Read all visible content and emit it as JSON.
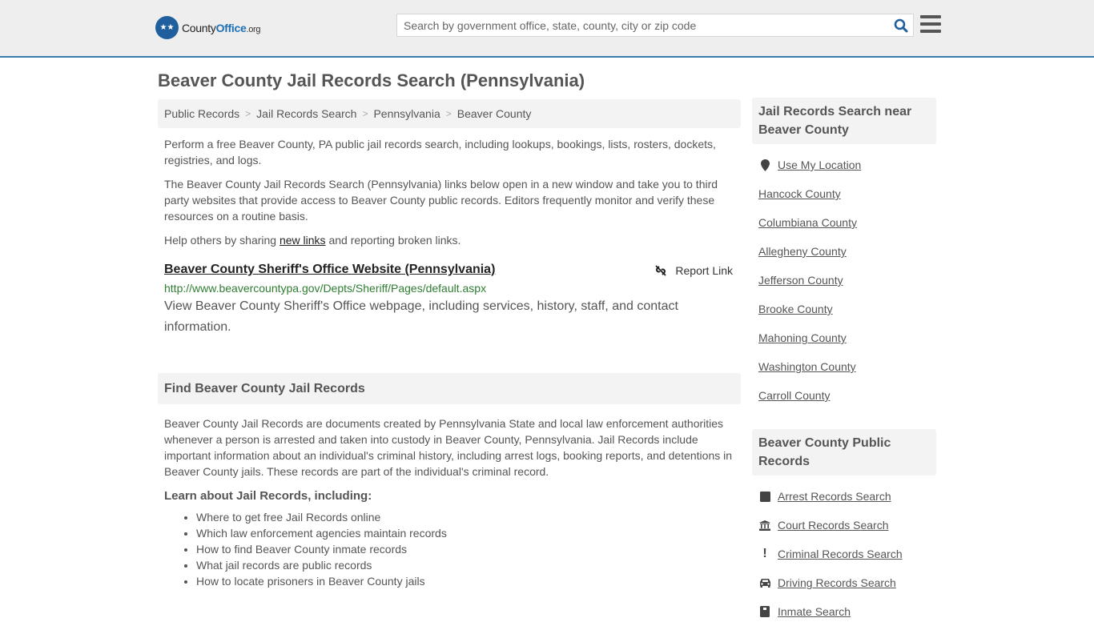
{
  "header": {
    "logo": {
      "brand_part1": "County",
      "brand_part2": "Office",
      "brand_suffix": ".org"
    },
    "search": {
      "placeholder": "Search by government office, state, county, city or zip code",
      "value": ""
    },
    "icons": {
      "search": "search-icon",
      "menu": "hamburger-menu-icon"
    }
  },
  "page": {
    "title": "Beaver County Jail Records Search (Pennsylvania)"
  },
  "breadcrumb": [
    {
      "label": "Public Records"
    },
    {
      "label": "Jail Records Search"
    },
    {
      "label": "Pennsylvania"
    },
    {
      "label": "Beaver County"
    }
  ],
  "intro": {
    "p1": "Perform a free Beaver County, PA public jail records search, including lookups, bookings, lists, rosters, dockets, registries, and logs.",
    "p2": "The Beaver County Jail Records Search (Pennsylvania) links below open in a new window and take you to third party websites that provide access to Beaver County public records. Editors frequently monitor and verify these resources on a routine basis.",
    "p3_before": "Help others by sharing ",
    "p3_link": "new links",
    "p3_after": " and reporting broken links."
  },
  "result": {
    "title": "Beaver County Sheriff's Office Website (Pennsylvania)",
    "report_label": "Report Link",
    "url": "http://www.beavercountypa.gov/Depts/Sheriff/Pages/default.aspx",
    "description": "View Beaver County Sheriff's Office webpage, including services, history, staff, and contact information."
  },
  "find_section": {
    "heading": "Find Beaver County Jail Records",
    "body": "Beaver County Jail Records are documents created by Pennsylvania State and local law enforcement authorities whenever a person is arrested and taken into custody in Beaver County, Pennsylvania. Jail Records include important information about an individual's criminal history, including arrest logs, booking reports, and detentions in Beaver County jails. These records are part of the individual's criminal record.",
    "learn_heading": "Learn about Jail Records, including:",
    "bullets": [
      "Where to get free Jail Records online",
      "Which law enforcement agencies maintain records",
      "How to find Beaver County inmate records",
      "What jail records are public records",
      "How to locate prisoners in Beaver County jails"
    ]
  },
  "sidebar": {
    "nearby": {
      "heading": "Jail Records Search near Beaver County",
      "use_location": "Use My Location",
      "counties": [
        "Hancock County",
        "Columbiana County",
        "Allegheny County",
        "Jefferson County",
        "Brooke County",
        "Mahoning County",
        "Washington County",
        "Carroll County"
      ]
    },
    "public_records": {
      "heading": "Beaver County Public Records",
      "items": [
        {
          "label": "Arrest Records Search",
          "icon": "book-icon"
        },
        {
          "label": "Court Records Search",
          "icon": "courthouse-icon"
        },
        {
          "label": "Criminal Records Search",
          "icon": "exclamation-icon"
        },
        {
          "label": "Driving Records Search",
          "icon": "car-icon"
        },
        {
          "label": "Inmate Search",
          "icon": "id-badge-icon"
        }
      ]
    }
  }
}
